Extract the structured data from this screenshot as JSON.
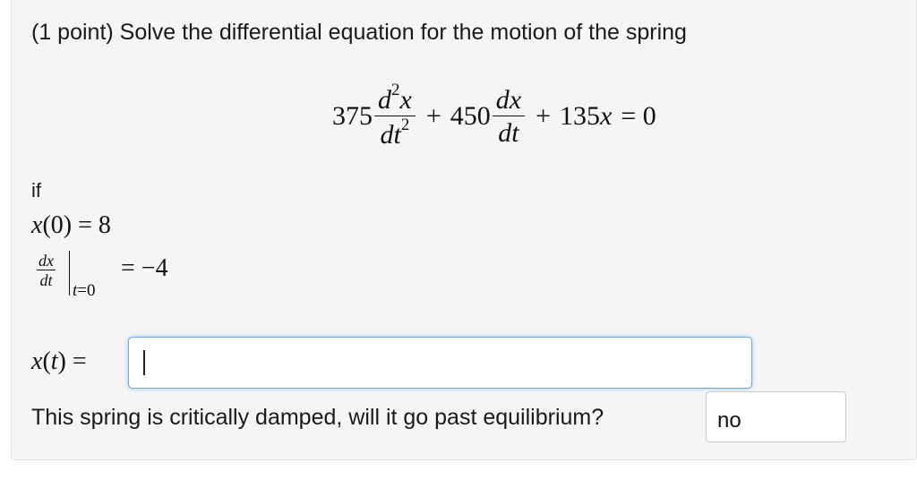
{
  "problem": {
    "prompt": "(1 point) Solve the differential equation for the motion of the spring",
    "equation": {
      "coef_a": "375",
      "d2x_num": "d",
      "d2x_sup": "2",
      "d2x_var": "x",
      "d2x_den": "dt",
      "d2x_den_sup": "2",
      "plus1": "+",
      "coef_b": "450",
      "dx_num": "dx",
      "dx_den": "dt",
      "plus2": "+",
      "coef_c": "135",
      "var_x": "x",
      "equals_zero": "= 0"
    },
    "if_label": "if",
    "condition1": {
      "lhs": "x",
      "arg": "(0)",
      "rhs": "= 8"
    },
    "condition2": {
      "num": "dx",
      "den": "dt",
      "subscript_var": "t",
      "subscript_rest": "=0",
      "rhs": "= −4"
    }
  },
  "answer": {
    "label_var": "x",
    "label_arg_open": "(",
    "label_arg": "t",
    "label_arg_close": ")",
    "label_eq": "=",
    "input_value": ""
  },
  "question": {
    "text": "This spring is critically damped, will it go past equilibrium?",
    "selected": "no"
  }
}
